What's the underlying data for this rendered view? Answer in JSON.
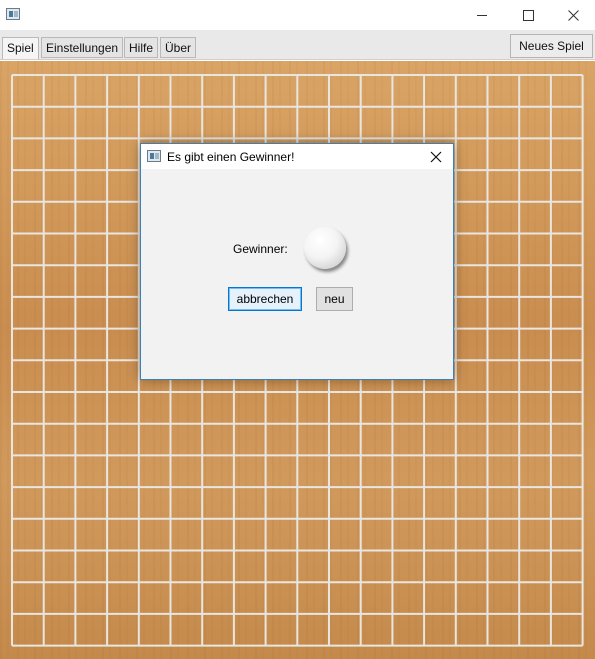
{
  "window": {
    "title": "",
    "controls": {
      "minimize": "minimize-icon",
      "maximize": "maximize-icon",
      "close": "close-icon"
    }
  },
  "tabs": [
    {
      "label": "Spiel",
      "active": true
    },
    {
      "label": "Einstellungen",
      "active": false
    },
    {
      "label": "Hilfe",
      "active": false
    },
    {
      "label": "Über",
      "active": false
    }
  ],
  "toolbar": {
    "new_game_label": "Neues Spiel"
  },
  "board": {
    "wood_color": "#d29a5b",
    "grid_color": "#e9e6e1"
  },
  "dialog": {
    "title": "Es gibt einen Gewinner!",
    "winner_label": "Gewinner:",
    "winner_stone": "white",
    "buttons": {
      "cancel": "abbrechen",
      "new": "neu"
    }
  }
}
